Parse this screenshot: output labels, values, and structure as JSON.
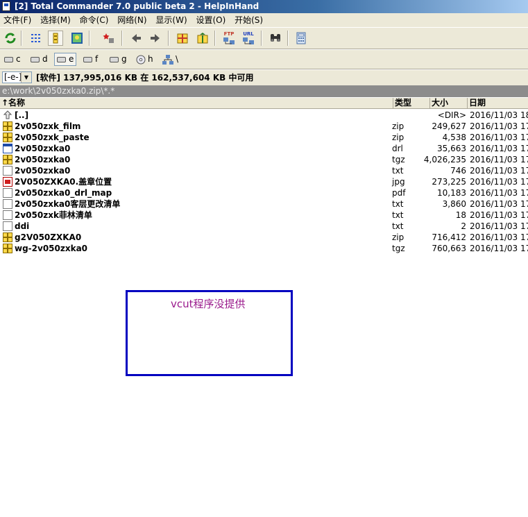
{
  "window": {
    "title": "[2] Total Commander 7.0 public beta 2 - HelpInHand"
  },
  "menu": [
    "文件(F)",
    "选择(M)",
    "命令(C)",
    "网络(N)",
    "显示(W)",
    "设置(O)",
    "开始(S)"
  ],
  "toolbar": {
    "icons": [
      "refresh-icon",
      "brief-view-icon",
      "full-view-icon",
      "thumbnail-icon",
      "invert-selection-icon",
      "back-icon",
      "forward-icon",
      "pack-icon",
      "unpack-icon",
      "ftp-icon",
      "url-icon",
      "find-icon",
      "calculator-icon"
    ],
    "ftp_label": "FTP",
    "url_label": "URL"
  },
  "drives": [
    {
      "label": "c",
      "pressed": false
    },
    {
      "label": "d",
      "pressed": false
    },
    {
      "label": "e",
      "pressed": true
    },
    {
      "label": "f",
      "pressed": false
    },
    {
      "label": "g",
      "pressed": false
    },
    {
      "label": "h",
      "pressed": false
    },
    {
      "label": "\\",
      "pressed": false
    }
  ],
  "drive_select": {
    "value": "[-e-]"
  },
  "status": {
    "space_text": "[软件]  137,995,016 KB 在  162,537,604 KB 中可用"
  },
  "path": "e:\\work\\2v050zxka0.zip\\*.*",
  "columns": {
    "name": "↑名称",
    "type": "类型",
    "size": "大小",
    "date": "日期"
  },
  "files": [
    {
      "icon": "up",
      "name": "[..]",
      "type": "",
      "size": "<DIR>",
      "date": "2016/11/03 18"
    },
    {
      "icon": "zip",
      "name": "2v050zxk_film",
      "type": "zip",
      "size": "249,627",
      "date": "2016/11/03 17"
    },
    {
      "icon": "zip",
      "name": "2v050zxk_paste",
      "type": "zip",
      "size": "4,538",
      "date": "2016/11/03 17"
    },
    {
      "icon": "drl",
      "name": "2v050zxka0",
      "type": "drl",
      "size": "35,663",
      "date": "2016/11/03 17"
    },
    {
      "icon": "zip",
      "name": "2v050zxka0",
      "type": "tgz",
      "size": "4,026,235",
      "date": "2016/11/03 17"
    },
    {
      "icon": "file",
      "name": "2v050zxka0",
      "type": "txt",
      "size": "746",
      "date": "2016/11/03 17"
    },
    {
      "icon": "jpg",
      "name": "2V050ZXKA0.盖章位置",
      "type": "jpg",
      "size": "273,225",
      "date": "2016/11/03 17"
    },
    {
      "icon": "file",
      "name": "2v050zxka0_drl_map",
      "type": "pdf",
      "size": "10,183",
      "date": "2016/11/03 17"
    },
    {
      "icon": "file",
      "name": "2v050zxka0客层更改清单",
      "type": "txt",
      "size": "3,860",
      "date": "2016/11/03 17"
    },
    {
      "icon": "file",
      "name": "2v050zxk菲林清单",
      "type": "txt",
      "size": "18",
      "date": "2016/11/03 17"
    },
    {
      "icon": "file",
      "name": "ddi",
      "type": "txt",
      "size": "2",
      "date": "2016/11/03 17"
    },
    {
      "icon": "zip",
      "name": "g2V050ZXKA0",
      "type": "zip",
      "size": "716,412",
      "date": "2016/11/03 17"
    },
    {
      "icon": "zip",
      "name": "wg-2v050zxka0",
      "type": "tgz",
      "size": "760,663",
      "date": "2016/11/03 17"
    }
  ],
  "note": {
    "text": "vcut程序没提供",
    "border_color": "#0000c0",
    "text_color": "#9a1a8c"
  }
}
